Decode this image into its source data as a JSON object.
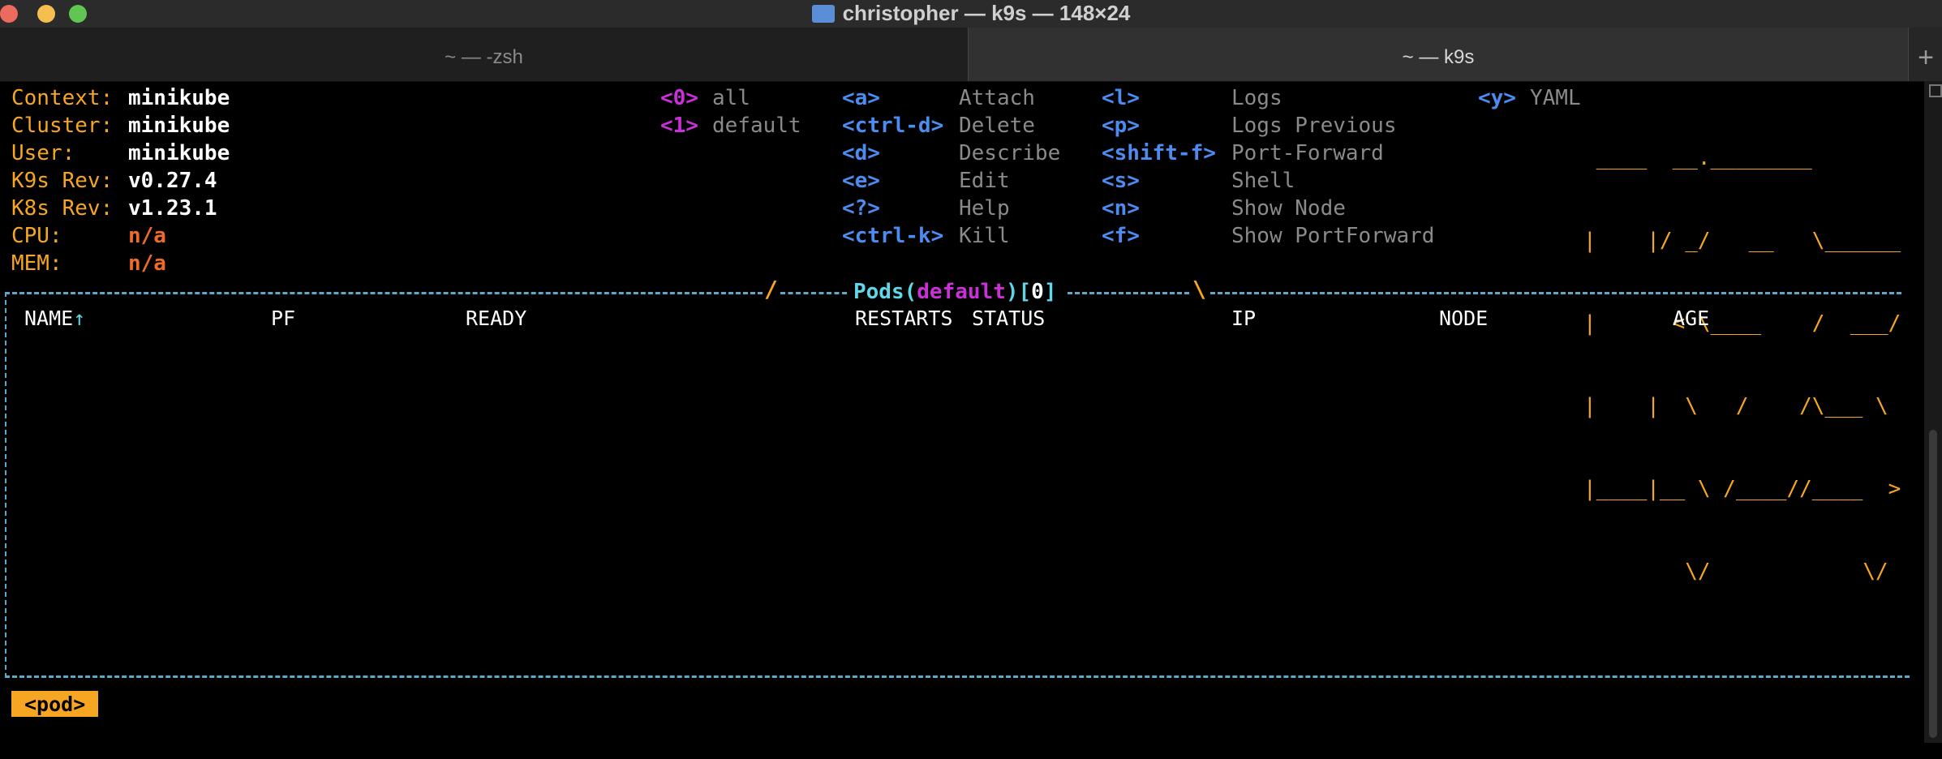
{
  "window": {
    "title": "christopher — k9s — 148×24",
    "tabs": [
      {
        "label": "~ — -zsh",
        "active": false
      },
      {
        "label": "~ — k9s",
        "active": true
      }
    ],
    "new_tab_label": "+"
  },
  "info": [
    {
      "label": "Context:",
      "value": "minikube"
    },
    {
      "label": "Cluster:",
      "value": "minikube"
    },
    {
      "label": "User:",
      "value": "minikube"
    },
    {
      "label": "K9s Rev:",
      "value": "v0.27.4"
    },
    {
      "label": "K8s Rev:",
      "value": "v1.23.1"
    },
    {
      "label": "CPU:",
      "value": "n/a"
    },
    {
      "label": "MEM:",
      "value": "n/a"
    }
  ],
  "namespaces": [
    {
      "key": "<0>",
      "name": "all"
    },
    {
      "key": "<1>",
      "name": "default"
    }
  ],
  "shortcuts_col1": [
    {
      "key": "<a>",
      "action": "Attach"
    },
    {
      "key": "<ctrl-d>",
      "action": "Delete"
    },
    {
      "key": "<d>",
      "action": "Describe"
    },
    {
      "key": "<e>",
      "action": "Edit"
    },
    {
      "key": "<?>",
      "action": "Help"
    },
    {
      "key": "<ctrl-k>",
      "action": "Kill"
    }
  ],
  "shortcuts_col2": [
    {
      "key": "<l>",
      "action": "Logs"
    },
    {
      "key": "<p>",
      "action": "Logs Previous"
    },
    {
      "key": "<shift-f>",
      "action": "Port-Forward"
    },
    {
      "key": "<s>",
      "action": "Shell"
    },
    {
      "key": "<n>",
      "action": "Show Node"
    },
    {
      "key": "<f>",
      "action": "Show PortForward"
    }
  ],
  "shortcuts_col3": [
    {
      "key": "<y>",
      "action": "YAML"
    }
  ],
  "logo_lines": [
    " ____  __.________",
    "|    |/ _/   __   \\______",
    "|      < \\____    /  ___/",
    "|    |  \\   /    /\\___ \\",
    "|____|__ \\ /____//____  >",
    "        \\/            \\/"
  ],
  "table": {
    "resource": "Pods",
    "namespace": "default",
    "count": "0",
    "columns": [
      "NAME",
      "PF",
      "READY",
      "RESTARTS",
      "STATUS",
      "IP",
      "NODE",
      "AGE"
    ],
    "sort_indicator": "↑",
    "rows": []
  },
  "breadcrumb": "<pod>",
  "colors": {
    "accent": "#f6a623",
    "key_blue": "#4c8cf0",
    "namespace_magenta": "#c930d8",
    "border_cyan": "#5ba8c8"
  }
}
